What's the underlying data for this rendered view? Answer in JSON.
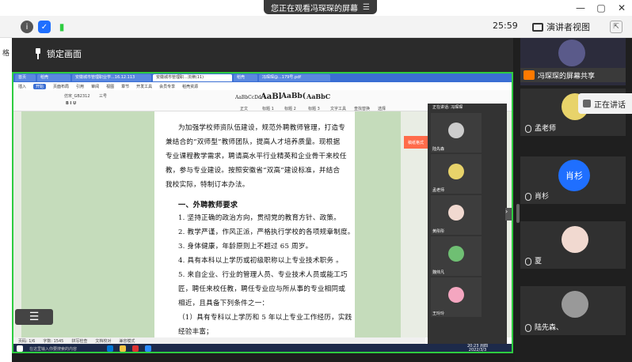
{
  "banner": {
    "text": "您正在观看冯琛琛的屏幕",
    "menu_icon": "menu-icon"
  },
  "window_controls": {
    "minimize": "—",
    "restore": "▢",
    "close": "✕"
  },
  "toolbar": {
    "timer": "25:59",
    "presenter_view": "演讲者视图",
    "icons": [
      "info-icon",
      "shield-icon",
      "signal-icon",
      "expand-icon"
    ]
  },
  "left_strip": {
    "label": "格"
  },
  "lock": {
    "label": "锁定画面"
  },
  "screen": {
    "tabs": [
      "首页",
      "稻壳",
      "安徽城市管理职业学...16.12.113",
      "安徽城市管理职...法律(11)",
      "稻壳",
      "冯琛琛@...179号.pdf"
    ],
    "menu": [
      "开始",
      "插入",
      "页面布局",
      "引用",
      "审阅",
      "视图",
      "章节",
      "开发工具",
      "会员专享",
      "稻壳资源"
    ],
    "menu_active": "开始",
    "ribbon": {
      "font": "仿宋_GB2312",
      "size": "三号",
      "styles": [
        "AaBbCcDd",
        "AaBl",
        "AaBb(",
        "AaBbC"
      ],
      "style_labels": [
        "正文",
        "标题 1",
        "标题 2",
        "标题 3"
      ],
      "right": [
        "文字工具",
        "查找替换",
        "选择"
      ]
    },
    "doc_lines": [
      "为加强学校师资队伍建设，规范外聘教师管理，打造专",
      "兼结合的“双师型”教师团队，提高人才培养质量。现根据",
      "专业课程教学需求，聘请高水平行业精英和企业骨干来校任",
      "教，参与专业建设。按照安徽省“双高”建设标准，并结合",
      "我校实际，特制订本办法。",
      "一、外聘教师要求",
      "1. 坚持正确的政治方向，贯彻党的教育方针、政策。",
      "2. 教学严谨，作风正派，严格执行学校的各项规章制度。",
      "3. 身体健康，年龄原则上不超过 65 周岁。",
      "4. 具有本科以上学历或初级职称以上专业技术职务 。",
      "5. 来自企业、行业的管理人员、专业技术人员或能工巧",
      "匠，聘任来校任教，聘任专业应与所从事的专业相同或",
      "相近，且具备下列条件之一：",
      "（1）具有专科以上学历和 5 年以上专业工作经历，实践",
      "经验丰富；"
    ],
    "side_button": "稿纸格式",
    "status": [
      "页码: 1/6",
      "字数: 1545",
      "拼写检查",
      "文档校对",
      "兼容模式"
    ],
    "taskbar_search": "在这里输入你要搜索的内容",
    "clock_time": "20:23 周四",
    "clock_date": "2022/3/3",
    "inner_panel": {
      "header": "正在讲话: 冯琛琛",
      "participants": [
        "陆先森",
        "孟老师",
        "黄彤彤",
        "魏帅凡",
        "王玲玲"
      ]
    }
  },
  "right_panel": {
    "share_label": "冯琛琛的屏幕共享",
    "speaking": "正在讲话",
    "participants": [
      {
        "name": "孟老师",
        "avatar_color": "#e8d36a"
      },
      {
        "name": "肖杉",
        "avatar_color": "#1f6fff",
        "avatar_text": "肖杉"
      },
      {
        "name": "夏",
        "avatar_color": "#f1d9d0"
      },
      {
        "name": "陆先森、",
        "avatar_color": "#999999"
      }
    ]
  },
  "colors": {
    "accent_green": "#2ecc40",
    "wps_blue": "#3b6fd4",
    "doc_green": "#c5dcbb"
  }
}
